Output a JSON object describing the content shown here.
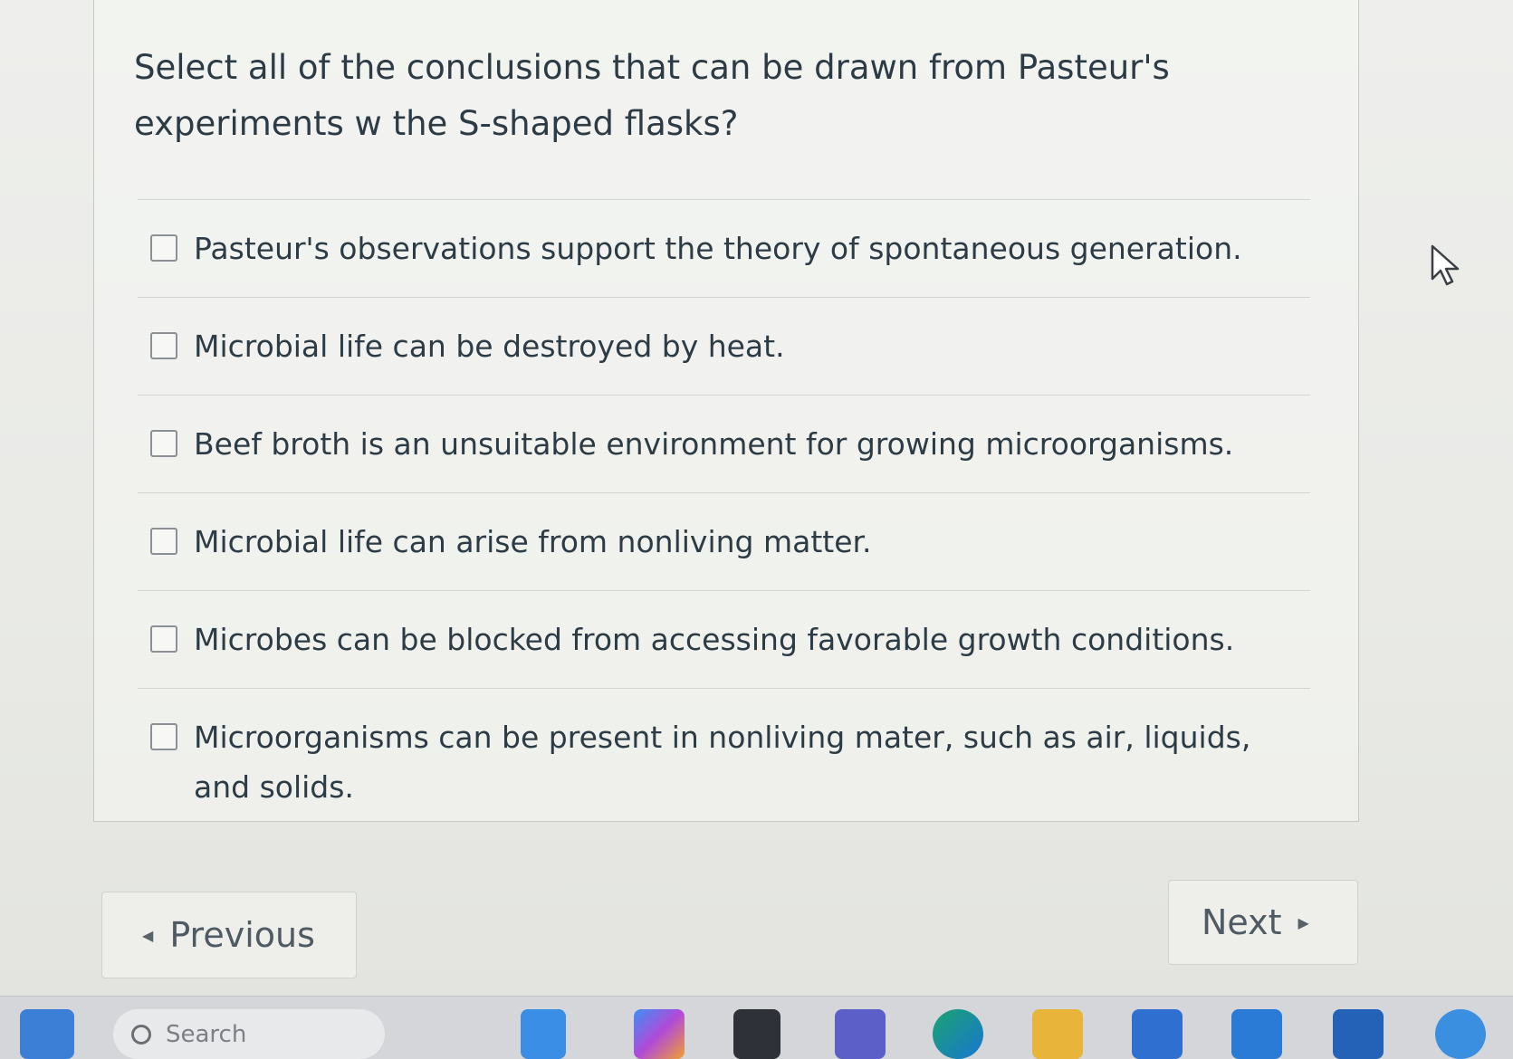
{
  "question": {
    "text": "Select all of the conclusions that can be drawn from Pasteur's experiments w the S-shaped flasks?"
  },
  "answers": [
    {
      "label": "Pasteur's observations support the theory of spontaneous generation.",
      "checked": false
    },
    {
      "label": "Microbial life can be destroyed by heat.",
      "checked": false
    },
    {
      "label": "Beef broth is an unsuitable environment for growing microorganisms.",
      "checked": false
    },
    {
      "label": "Microbial life can arise from nonliving matter.",
      "checked": false
    },
    {
      "label": "Microbes can be blocked from accessing favorable growth conditions.",
      "checked": false
    },
    {
      "label": "Microorganisms can be present in nonliving mater, such as air, liquids, and solids.",
      "checked": false
    }
  ],
  "navigation": {
    "previous_label": "Previous",
    "next_label": "Next"
  },
  "taskbar": {
    "search_placeholder": "Search",
    "icons": [
      "windows-start-icon",
      "search-icon",
      "widgets-icon",
      "copilot-icon",
      "task-view-icon",
      "teams-icon",
      "edge-icon",
      "file-explorer-icon",
      "store-icon",
      "mail-icon",
      "app-icon",
      "sync-icon"
    ]
  },
  "colors": {
    "text": "#2d3b45",
    "border": "#c6c8c3",
    "background": "#eeefec"
  }
}
